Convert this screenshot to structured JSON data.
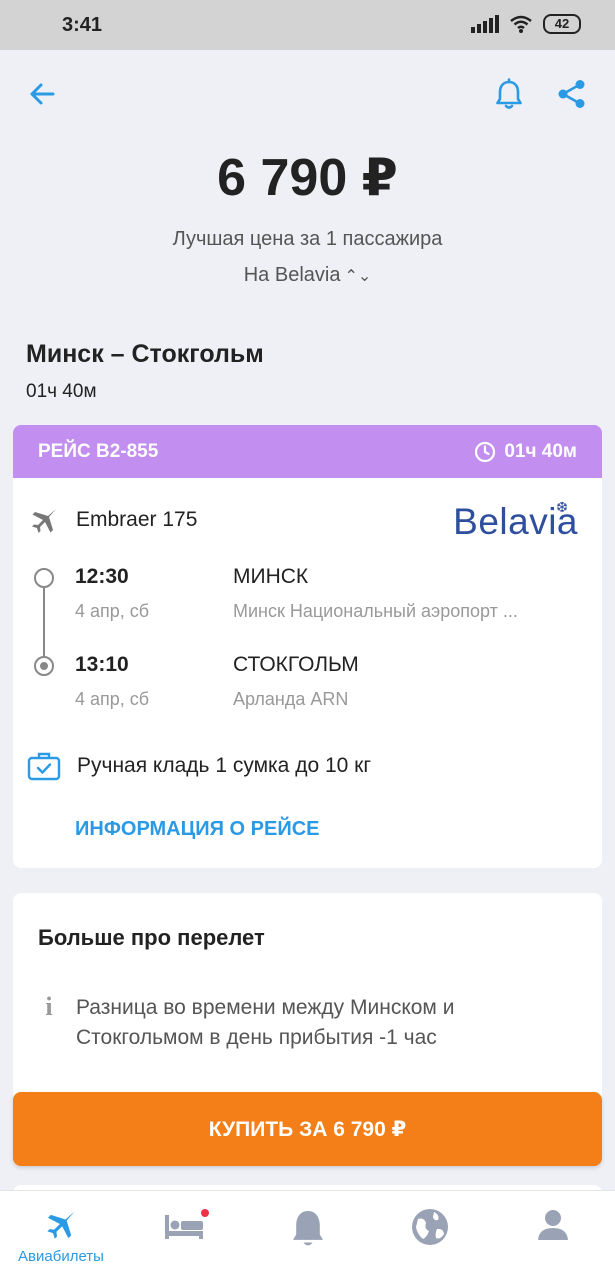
{
  "status_bar": {
    "time": "3:41",
    "battery": "42"
  },
  "header": {
    "price": "6 790 ₽",
    "price_caption": "Лучшая цена за 1 пассажира",
    "airline_selector": "На Belavia"
  },
  "route": {
    "title": "Минск – Стокгольм",
    "duration": "01ч 40м"
  },
  "flight": {
    "number": "РЕЙС B2-855",
    "duration": "01ч 40м",
    "aircraft": "Embraer 175",
    "airline_logo": "Belavia",
    "departure": {
      "time": "12:30",
      "date": "4 апр, сб",
      "city": "МИНСК",
      "airport": "Минск Национальный аэропорт ..."
    },
    "arrival": {
      "time": "13:10",
      "date": "4 апр, сб",
      "city": "СТОКГОЛЬМ",
      "airport": "Арланда ARN"
    },
    "baggage": "Ручная кладь 1 сумка до 10 кг",
    "info_link": "ИНФОРМАЦИЯ О РЕЙСЕ"
  },
  "more": {
    "title": "Больше про перелет",
    "note": "Разница во времени между Минском и Стокгольмом в день прибытия -1 час"
  },
  "buy_button": "КУПИТЬ ЗА 6 790 ₽",
  "tabbar": {
    "items": [
      {
        "label": "Авиабилеты",
        "icon": "plane-icon",
        "active": true
      },
      {
        "label": "",
        "icon": "hotel-bed-icon",
        "badge": true
      },
      {
        "label": "",
        "icon": "bell-icon"
      },
      {
        "label": "",
        "icon": "globe-icon"
      },
      {
        "label": "",
        "icon": "profile-icon"
      }
    ]
  },
  "colors": {
    "accent": "#2a9ae4",
    "flight_header": "#c28ef0",
    "buy_button": "#f47e17",
    "logo": "#2e4e9e",
    "badge": "#ee3049"
  }
}
